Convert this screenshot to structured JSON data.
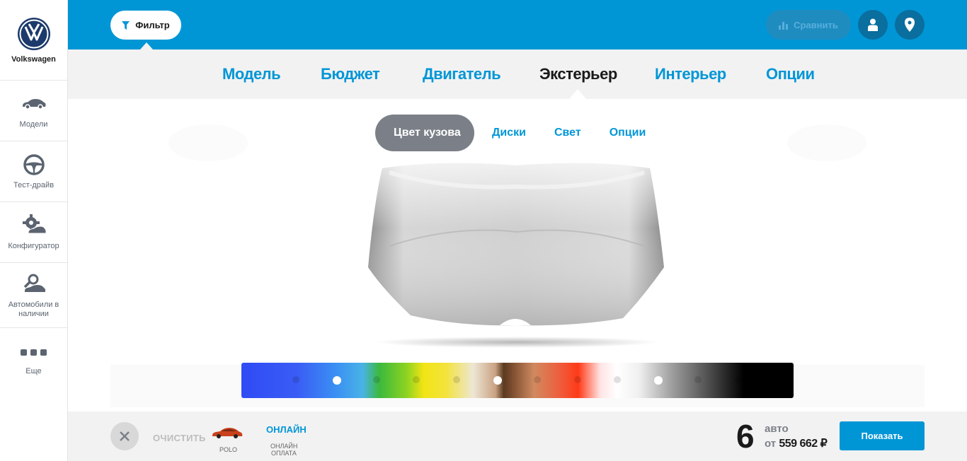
{
  "brand": {
    "name": "Volkswagen",
    "logo_letters": "VW"
  },
  "sidebar": {
    "items": [
      {
        "label": "Модели",
        "icon": "car-icon"
      },
      {
        "label": "Тест-драйв",
        "icon": "steering-wheel-icon"
      },
      {
        "label": "Конфигуратор",
        "icon": "configurator-gear-car-icon"
      },
      {
        "label": "Автомобили в наличии",
        "icon": "car-search-icon"
      },
      {
        "label": "Еще",
        "icon": "more-dots-icon"
      }
    ]
  },
  "topbar": {
    "filter_label": "Фильтр",
    "compare_label": "Сравнить",
    "color": "#0096d6"
  },
  "tabs": [
    {
      "label": "Модель",
      "active": false
    },
    {
      "label": "Бюджет",
      "active": false
    },
    {
      "label": "Двигатель",
      "active": false
    },
    {
      "label": "Экстерьер",
      "active": true
    },
    {
      "label": "Интерьер",
      "active": false
    },
    {
      "label": "Опции",
      "active": false
    }
  ],
  "subtabs": [
    {
      "label": "Цвет кузова",
      "active": true
    },
    {
      "label": "Диски",
      "active": false
    },
    {
      "label": "Свет",
      "active": false
    },
    {
      "label": "Опции",
      "active": false
    }
  ],
  "swatches": [
    {
      "color": "#4a6cf8",
      "selected": false
    },
    {
      "color": "#ffffff",
      "selected": true
    },
    {
      "color": "#62c93d",
      "selected": false
    },
    {
      "color": "#f7eb3a",
      "selected": false
    },
    {
      "color": "#e8d6c4",
      "selected": false
    },
    {
      "color": "#ffffff",
      "selected": true
    },
    {
      "color": "#e6926a",
      "selected": false
    },
    {
      "color": "#ff5a3c",
      "selected": false
    },
    {
      "color": "#e8e8e8",
      "selected": false
    },
    {
      "color": "#ffffff",
      "selected": true
    },
    {
      "color": "#6e6e6e",
      "selected": false
    },
    {
      "color": "#2b2b2b",
      "selected": false
    }
  ],
  "bottom": {
    "clear_label": "ОЧИСТИТЬ",
    "model_label": "POLO",
    "online_title": "ОНЛАЙН",
    "online_sub": "ОНЛАЙН ОПЛАТА",
    "count": "6",
    "count_unit": "авто",
    "price_prefix": "от",
    "price": "559 662 ₽",
    "show_label": "Показать"
  }
}
